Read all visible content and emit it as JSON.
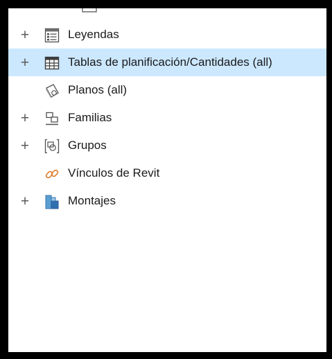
{
  "browser_tree": {
    "items": [
      {
        "label": "Leyendas",
        "toggle": "+",
        "icon": "legend-icon"
      },
      {
        "label": "Tablas de planificación/Cantidades (all)",
        "toggle": "+",
        "icon": "schedule-table-icon",
        "selected": true
      },
      {
        "label": "Planos (all)",
        "toggle": "",
        "icon": "sheet-icon"
      },
      {
        "label": "Familias",
        "toggle": "+",
        "icon": "families-icon"
      },
      {
        "label": "Grupos",
        "toggle": "+",
        "icon": "groups-icon"
      },
      {
        "label": "Vínculos de Revit",
        "toggle": "",
        "icon": "revit-links-icon"
      },
      {
        "label": "Montajes",
        "toggle": "+",
        "icon": "assemblies-icon"
      }
    ],
    "selection_color": "#cce8ff"
  }
}
